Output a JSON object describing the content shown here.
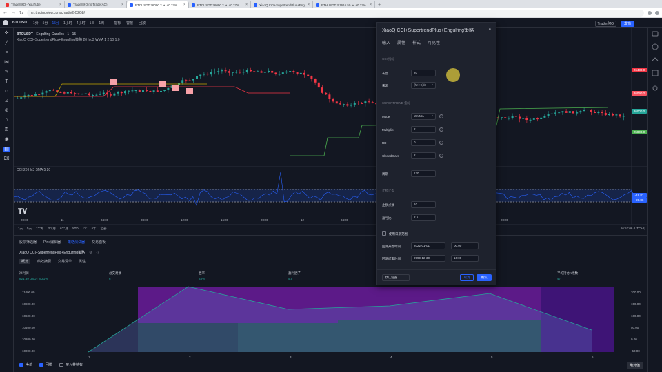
{
  "browser": {
    "tabs": [
      {
        "label": "Trader阿Q - YouTube",
        "icon": "youtube-icon",
        "active": false
      },
      {
        "label": "Trader阿Q (@TraderAQ)",
        "icon": "tradingview-icon",
        "active": false
      },
      {
        "label": "BTCUSDT 26090.2 ▲ +0.27%",
        "icon": "tradingview-icon",
        "active": true
      },
      {
        "label": "BTCUSDT 26090.2 ▲ +0.27%",
        "icon": "tradingview-icon",
        "active": false
      },
      {
        "label": "XiaoQ CCI+SupertrendPlus+Engulfing",
        "icon": "tradingview-icon",
        "active": false
      },
      {
        "label": "ETHUSDT.P 1616.50 ▲ +0.33%",
        "icon": "tradingview-icon",
        "active": false
      }
    ],
    "url": "cn.tradingview.com/chart/VGC2G8/"
  },
  "toolbar": {
    "symbol": "BTCUSDT",
    "intervals": [
      "1分",
      "5分",
      "15分",
      "1小时",
      "4小时",
      "1日",
      "1周"
    ],
    "selected_interval": "15分",
    "items": [
      "指标",
      "警报",
      "回放"
    ],
    "layout_name": "Trader阿Q",
    "publish_label": "发布"
  },
  "chart": {
    "legend_line1": "Engulfing Candles · 1 · 15",
    "legend_line2": "XiaoQ CCI+SupertrendPlus+Engulfing策略 20 hlc3 WMA 1 2 10 1.0",
    "legend_line3": "CCI 20 hlc3 SMA 5 20",
    "price_tags": [
      {
        "text": "26430.0",
        "color": "#f23645"
      },
      {
        "text": "26090.2",
        "color": "#f7525f"
      },
      {
        "text": "26000.0",
        "color": "#26a69a"
      },
      {
        "text": "25800.0",
        "color": "#4caf50"
      }
    ],
    "time_labels": [
      "20:00",
      "11",
      "04:00",
      "08:00",
      "12:00",
      "16:00",
      "20:00",
      "12",
      "04:00",
      "08:00",
      "12:00",
      "16:00",
      "20:00"
    ],
    "time_ranges": [
      "1天",
      "5天",
      "1个月",
      "3个月",
      "6个月",
      "YTD",
      "1年",
      "5年",
      "全部"
    ],
    "clock": "16:52:06 (UTC+8)",
    "cci_tags": [
      {
        "text": "-19.81",
        "color": "#2962ff"
      },
      {
        "text": "-20.86",
        "color": "#2962ff"
      }
    ]
  },
  "bottom": {
    "tabs": [
      {
        "label": "股票筛选器",
        "selected": false
      },
      {
        "label": "Pine编辑器",
        "selected": false
      },
      {
        "label": "策略测试器",
        "selected": true
      },
      {
        "label": "交易面板",
        "selected": false
      }
    ],
    "strategy_name": "XiaoQ CCI+SupertrendPlus+Engulfing策略",
    "subtabs": [
      {
        "label": "概览",
        "selected": true
      },
      {
        "label": "绩效摘要",
        "selected": false
      },
      {
        "label": "交易清单",
        "selected": false
      },
      {
        "label": "属性",
        "selected": false
      }
    ],
    "metrics": [
      {
        "label": "净利润",
        "value": "821.39 USDT 8.21%"
      },
      {
        "label": "总交易数",
        "value": "6"
      },
      {
        "label": "胜率",
        "value": "83%"
      },
      {
        "label": "盈利因子",
        "value": "5.5"
      },
      {
        "label": "最大回撤",
        "value": "117.46 USDT 1.17%"
      },
      {
        "label": "平均交易",
        "value": "136.90 USDT 1.37%"
      },
      {
        "label": "平均持仓K线数",
        "value": "47"
      }
    ],
    "perf_axis_left": [
      "11000.00",
      "10800.00",
      "10600.00",
      "10400.00",
      "10200.00",
      "10000.00"
    ],
    "perf_axis_right": [
      "200.00",
      "150.00",
      "100.00",
      "50.00",
      "0.00",
      "-50.00"
    ],
    "perf_x_labels": [
      "1",
      "2",
      "3",
      "4",
      "5",
      "6"
    ],
    "footer_options": [
      {
        "label": "净值",
        "checked": true
      },
      {
        "label": "回撤",
        "checked": true
      },
      {
        "label": "买入并持有",
        "checked": false
      }
    ],
    "footer_right": "绝对值"
  },
  "dialog": {
    "title": "XiaoQ CCI+SupertrendPlus+Engulfing策略",
    "tabs": [
      {
        "label": "输入",
        "selected": true
      },
      {
        "label": "属性",
        "selected": false
      },
      {
        "label": "样式",
        "selected": false
      },
      {
        "label": "可见性",
        "selected": false
      }
    ],
    "cci_section": "CCI 指标",
    "cci_length_label": "长度",
    "cci_length": "20",
    "cci_source_label": "来源",
    "cci_source": "(h+l+c)/3",
    "st_section": "SUPERTREND 指标",
    "mode_label": "Mode",
    "mode_value": "WMMA",
    "mult_label": "Multiplier",
    "mult_value": "2",
    "rd_label": "RD",
    "rd_value": "0",
    "closed_label": "Closed Bars",
    "closed_value": "2",
    "period_label": "周期",
    "period_value": "120",
    "sl_section": "止损止盈",
    "stop_label": "止损点数",
    "stop_value": "10",
    "rr_label": "盈亏比",
    "rr_value": "2.5",
    "range_label": "使用日期范围",
    "start_label": "回测开始时间",
    "start_date": "2022-01-01",
    "start_time": "00:00",
    "end_label": "回测结束时间",
    "end_date": "9999-12-30",
    "end_time": "16:00",
    "defaults_label": "默认设置",
    "cancel_label": "取消",
    "ok_label": "确认"
  }
}
